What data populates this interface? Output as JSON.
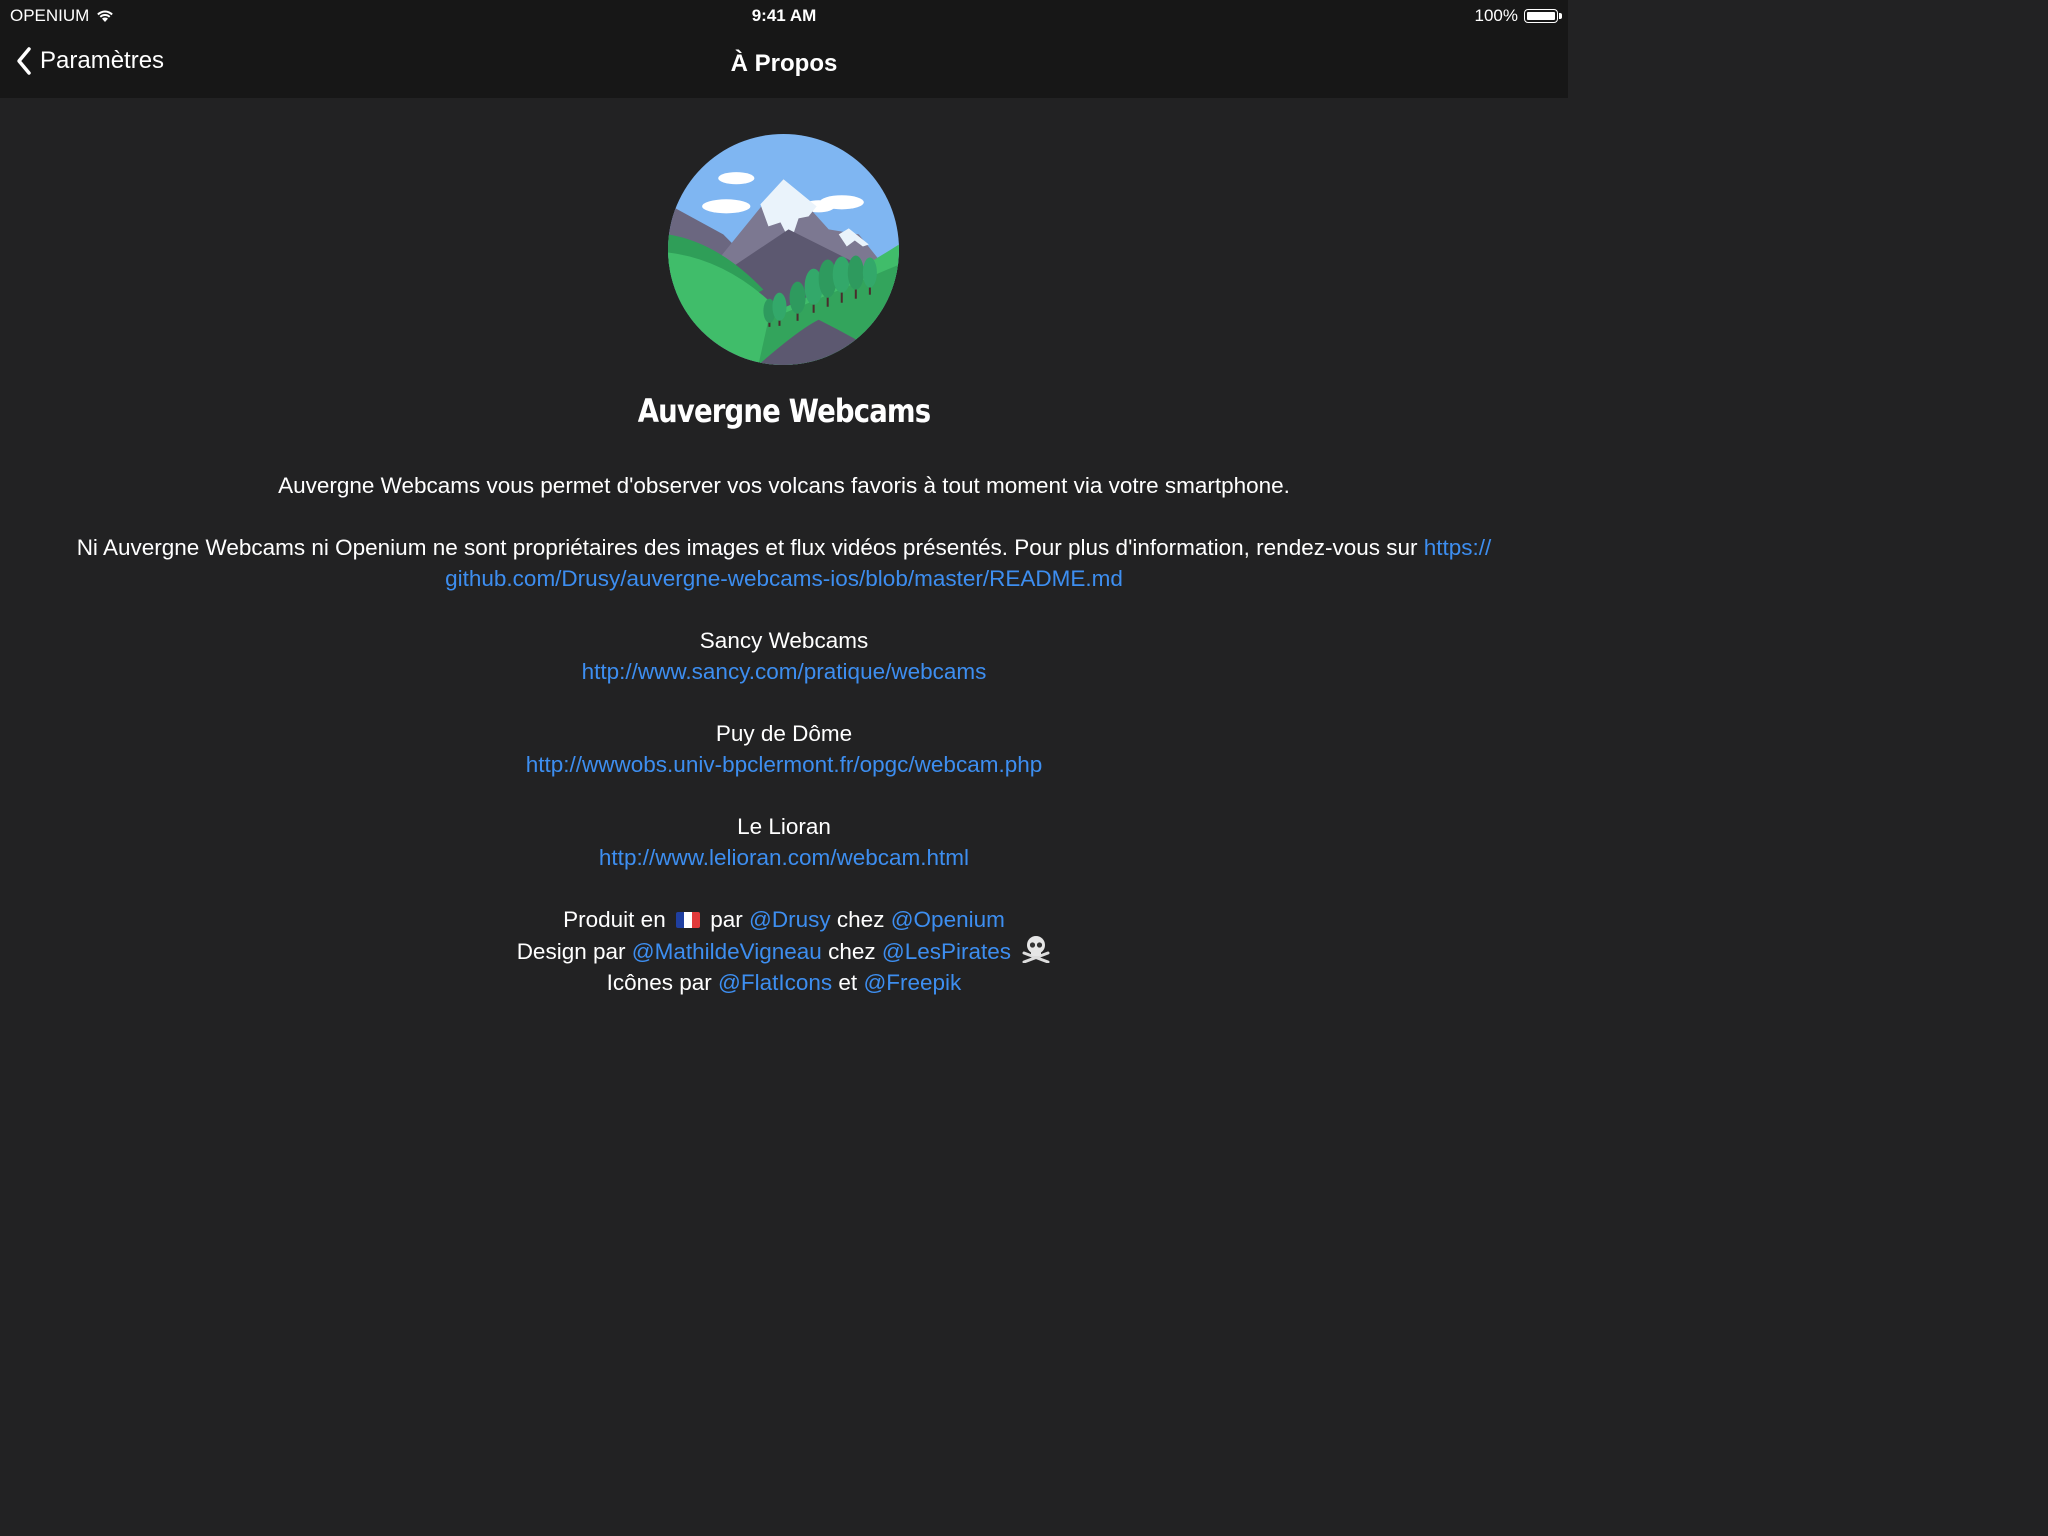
{
  "status_bar": {
    "carrier": "OPENIUM",
    "time": "9:41 AM",
    "battery": "100%"
  },
  "nav": {
    "back_label": "Paramètres",
    "title": "À Propos"
  },
  "app": {
    "name": "Auvergne Webcams",
    "description": "Auvergne Webcams vous permet d'observer vos volcans favoris à tout moment via votre smartphone."
  },
  "disclaimer": {
    "text": "Ni Auvergne Webcams ni Openium ne sont propriétaires des images et flux vidéos présentés. Pour plus d'information, rendez-vous sur ",
    "link_line1": "https://",
    "link_line2": "github.com/Drusy/auvergne-webcams-ios/blob/master/README.md"
  },
  "sources": [
    {
      "name": "Sancy Webcams",
      "url": "http://www.sancy.com/pratique/webcams"
    },
    {
      "name": "Puy de Dôme",
      "url": "http://wwwobs.univ-bpclermont.fr/opgc/webcam.php"
    },
    {
      "name": "Le Lioran",
      "url": "http://www.lelioran.com/webcam.html"
    }
  ],
  "credits": {
    "produced_prefix": "Produit en",
    "produced_par": "par",
    "produced_author": "@Drusy",
    "produced_chez": "chez",
    "produced_company": "@Openium",
    "design_prefix": "Design par",
    "design_author": "@MathildeVigneau",
    "design_chez": "chez",
    "design_company": "@LesPirates",
    "icons_prefix": "Icônes par",
    "icons_source1": "@FlatIcons",
    "icons_et": "et",
    "icons_source2": "@Freepik"
  }
}
